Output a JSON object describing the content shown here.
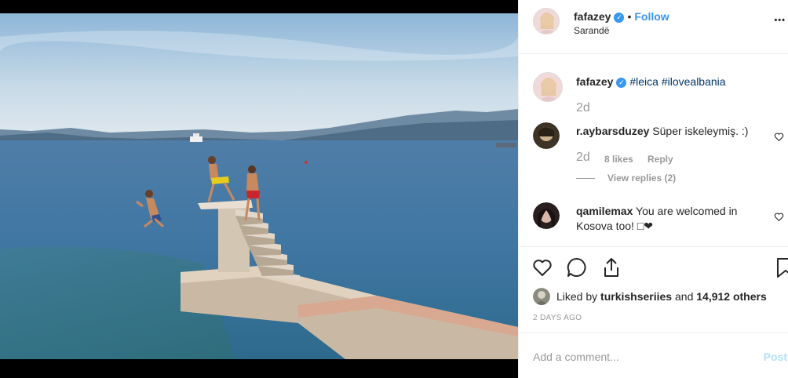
{
  "post": {
    "author": "fafazey",
    "location": "Sarandë",
    "follow_label": "Follow",
    "dot": "•",
    "more_label": "•••",
    "verified_mark": "✓"
  },
  "caption": {
    "user": "fafazey",
    "tags": "#leica #ilovealbania",
    "time": "2d"
  },
  "comments": [
    {
      "user": "r.aybarsduzey",
      "text": "Süper iskeleymiş. :)",
      "time": "2d",
      "likes": "8 likes",
      "reply": "Reply",
      "view_replies": "View replies (2)"
    },
    {
      "user": "qamilemax",
      "text_line1": "You are welcomed in",
      "text_line2": "Kosova too! □❤"
    }
  ],
  "actions": {
    "icons": [
      "heart-icon",
      "comment-icon",
      "share-icon",
      "bookmark-icon"
    ],
    "liked_prefix": "Liked by",
    "liked_user": "turkishseriies",
    "liked_and": "and",
    "liked_count": "14,912 others",
    "time_ago": "2 DAYS AGO"
  },
  "add_comment": {
    "placeholder": "Add a comment...",
    "post_label": "Post"
  },
  "colors": {
    "link": "#3897f0",
    "hashtag": "#003569",
    "muted": "#999999"
  }
}
